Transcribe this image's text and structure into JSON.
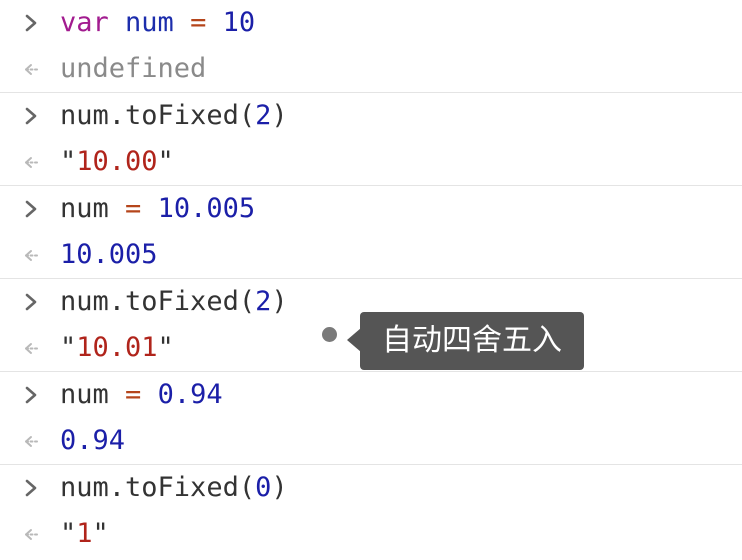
{
  "entries": [
    {
      "input": {
        "kw": "var",
        "name": "num",
        "op": "=",
        "value": "10"
      },
      "output": {
        "text": "undefined"
      }
    },
    {
      "input": {
        "obj": "num",
        "method": ".toFixed(",
        "arg": "2",
        "close": ")"
      },
      "output": {
        "open_quote": "\"",
        "value": "10.00",
        "close_quote": "\""
      }
    },
    {
      "input": {
        "name": "num",
        "op": "=",
        "value": "10.005"
      },
      "output": {
        "value": "10.005"
      }
    },
    {
      "input": {
        "obj": "num",
        "method": ".toFixed(",
        "arg": "2",
        "close": ")"
      },
      "output": {
        "open_quote": "\"",
        "value": "10.01",
        "close_quote": "\""
      }
    },
    {
      "input": {
        "name": "num",
        "op": "=",
        "value": "0.94"
      },
      "output": {
        "value": "0.94"
      }
    },
    {
      "input": {
        "obj": "num",
        "method": ".toFixed(",
        "arg": "0",
        "close": ")"
      },
      "output": {
        "open_quote": "\"",
        "value": "1",
        "close_quote": "\""
      }
    }
  ],
  "tooltip": {
    "text": "自动四舍五入"
  },
  "icons": {
    "input_prompt": "chevron-right-icon",
    "output_result": "return-arrow-icon"
  },
  "colors": {
    "keyword": "#a21b8f",
    "variable": "#1c2dac",
    "operator": "#b5451b",
    "number": "#1b1fa8",
    "string": "#b0241b",
    "undefined": "#8a8a8a",
    "tooltip_bg": "#555555"
  }
}
